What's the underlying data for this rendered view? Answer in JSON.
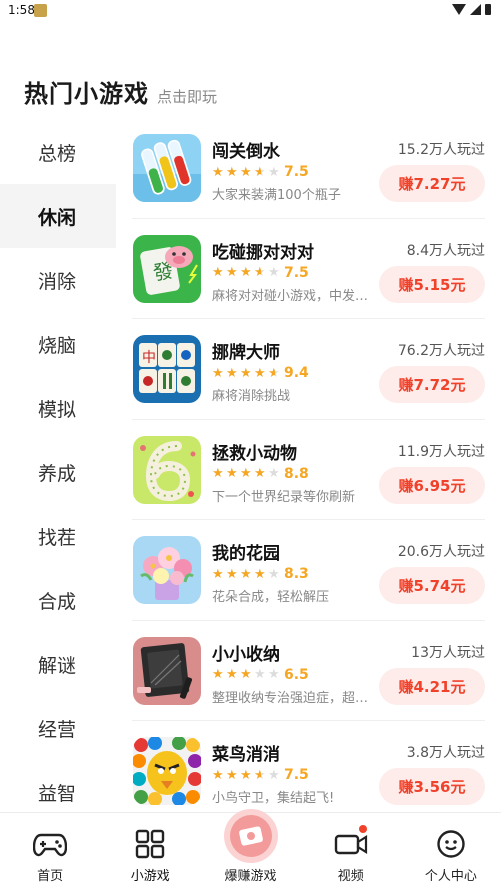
{
  "status_bar": {
    "time": "1:58"
  },
  "header": {
    "title": "热门小游戏",
    "subtitle": "点击即玩"
  },
  "categories": [
    {
      "label": "总榜",
      "active": false
    },
    {
      "label": "休闲",
      "active": true
    },
    {
      "label": "消除",
      "active": false
    },
    {
      "label": "烧脑",
      "active": false
    },
    {
      "label": "模拟",
      "active": false
    },
    {
      "label": "养成",
      "active": false
    },
    {
      "label": "找茬",
      "active": false
    },
    {
      "label": "合成",
      "active": false
    },
    {
      "label": "解谜",
      "active": false
    },
    {
      "label": "经营",
      "active": false
    },
    {
      "label": "益智",
      "active": false
    }
  ],
  "games": [
    {
      "name": "闯关倒水",
      "rating": 3.5,
      "score": "7.5",
      "desc": "大家来装满100个瓶子",
      "plays": "15.2万人玩过",
      "earn": "赚7.27元",
      "thumb": "water-sort-thumbnail"
    },
    {
      "name": "吃碰挪对对对",
      "rating": 3.5,
      "score": "7.5",
      "desc": "麻将对对碰小游戏，中发白，发财喽",
      "plays": "8.4万人玩过",
      "earn": "赚5.15元",
      "thumb": "mahjong-pig-thumbnail"
    },
    {
      "name": "挪牌大师",
      "rating": 4.5,
      "score": "9.4",
      "desc": "麻将消除挑战",
      "plays": "76.2万人玩过",
      "earn": "赚7.72元",
      "thumb": "mahjong-tiles-thumbnail"
    },
    {
      "name": "拯救小动物",
      "rating": 4,
      "score": "8.8",
      "desc": "下一个世界纪录等你刷新",
      "plays": "11.9万人玩过",
      "earn": "赚6.95元",
      "thumb": "snake-six-thumbnail"
    },
    {
      "name": "我的花园",
      "rating": 4,
      "score": "8.3",
      "desc": "花朵合成，轻松解压",
      "plays": "20.6万人玩过",
      "earn": "赚5.74元",
      "thumb": "flower-bouquet-thumbnail"
    },
    {
      "name": "小小收纳",
      "rating": 3,
      "score": "6.5",
      "desc": "整理收纳专治强迫症，超级解压",
      "plays": "13万人玩过",
      "earn": "赚4.21元",
      "thumb": "makeup-organizer-thumbnail"
    },
    {
      "name": "菜鸟消消",
      "rating": 3.5,
      "score": "7.5",
      "desc": "小鸟守卫，集结起飞!",
      "plays": "3.8万人玩过",
      "earn": "赚3.56元",
      "thumb": "angry-bird-thumbnail"
    }
  ],
  "nav": [
    {
      "label": "首页",
      "icon": "gamepad-icon",
      "active": false
    },
    {
      "label": "小游戏",
      "icon": "grid-icon",
      "active": true
    },
    {
      "label": "爆赚游戏",
      "icon": "money-icon",
      "active": false
    },
    {
      "label": "视频",
      "icon": "video-camera-icon",
      "active": false
    },
    {
      "label": "个人中心",
      "icon": "smiley-face-icon",
      "active": false
    }
  ],
  "colors": {
    "accent_red": "#f0412a",
    "earn_bg": "#fdecea",
    "star": "#f5a623",
    "active_cat_bg": "#f4f4f4"
  }
}
